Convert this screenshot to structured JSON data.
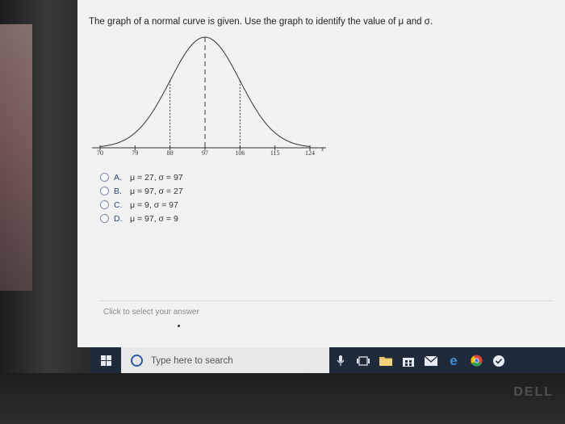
{
  "question": {
    "text": "The graph of a normal curve is given. Use the graph to identify the value of μ and σ."
  },
  "graph": {
    "tick_labels": [
      "70",
      "79",
      "88",
      "97",
      "106",
      "115",
      "124"
    ],
    "axis_end_label": "x",
    "mean": 97,
    "dashed_lines_at": [
      88,
      97,
      106
    ]
  },
  "options": [
    {
      "letter": "A.",
      "text": "μ = 27, σ = 97"
    },
    {
      "letter": "B.",
      "text": "μ = 97, σ = 27"
    },
    {
      "letter": "C.",
      "text": "μ = 9, σ = 97"
    },
    {
      "letter": "D.",
      "text": "μ = 97, σ = 9"
    }
  ],
  "answer_hint": "Click to select your answer",
  "taskbar": {
    "search_placeholder": "Type here to search",
    "icons": [
      "windows-icon",
      "microphone-icon",
      "task-view-icon",
      "file-explorer-icon",
      "store-icon",
      "mail-icon",
      "edge-icon",
      "chrome-icon",
      "checkmark-icon"
    ]
  },
  "monitor": {
    "brand": "DELL"
  }
}
